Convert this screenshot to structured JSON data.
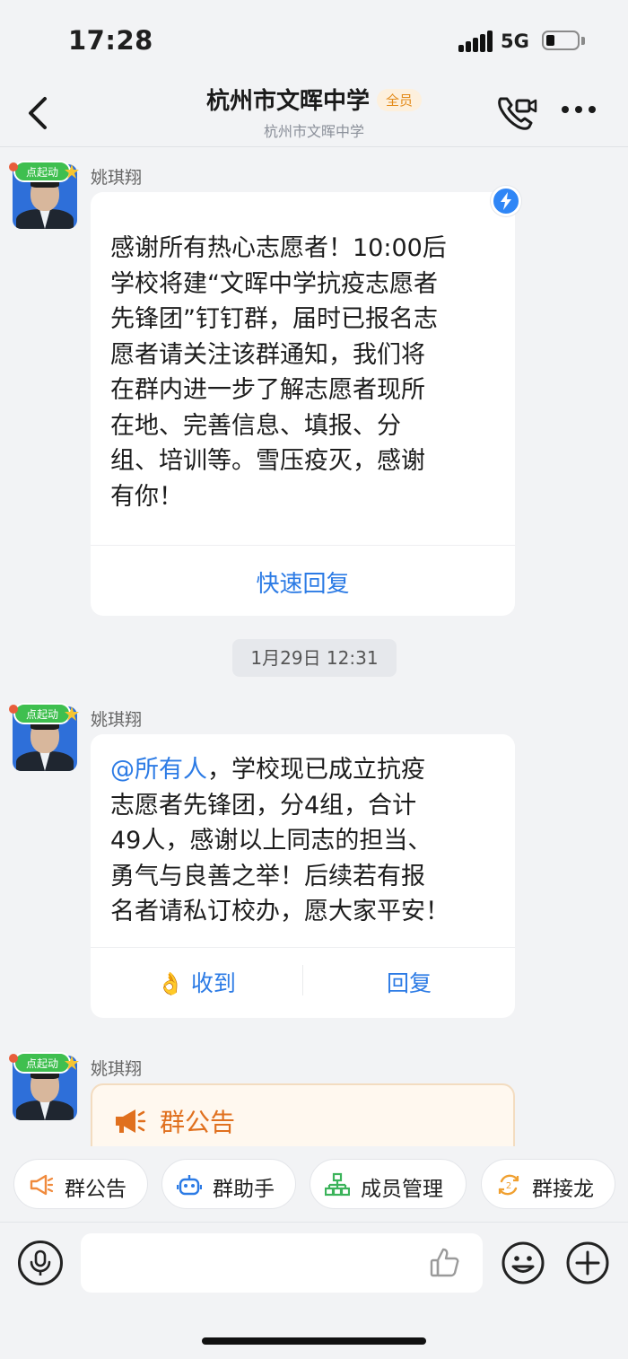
{
  "status_bar": {
    "time": "17:28",
    "network": "5G"
  },
  "header": {
    "title": "杭州市文晖中学",
    "badge": "全员",
    "subtitle": "杭州市文晖中学",
    "icons": [
      "back-icon",
      "video-call-icon",
      "more-icon"
    ]
  },
  "avatar_tag": "点起动",
  "messages": [
    {
      "sender": "姚琪翔",
      "lines": [
        "感谢所有热心志愿者！10:00后",
        "学校将建“文晖中学抗疫志愿者",
        "先锋团”钉钉群，届时已报名志",
        "愿者请关注该群通知，我们将",
        "在群内进一步了解志愿者现所",
        "在地、完善信息、填报、分",
        "组、培训等。雪压疫灭，感谢",
        "有你！"
      ],
      "action": "快速回复"
    },
    {
      "sender": "姚琪翔",
      "mention": "@所有人",
      "first_line_rest": "，学校现已成立抗疫",
      "lines": [
        "志愿者先锋团，分4组，合计",
        "49人，感谢以上同志的担当、",
        "勇气与良善之举！后续若有报",
        "名者请私订校办，愿大家平安！"
      ],
      "action_left": "收到",
      "action_right": "回复"
    },
    {
      "sender": "姚琪翔",
      "announcement_label": "群公告"
    }
  ],
  "timestamp": "1月29日 12:31",
  "toolbar": {
    "items": [
      {
        "label": "群公告",
        "icon": "megaphone-icon"
      },
      {
        "label": "群助手",
        "icon": "robot-icon"
      },
      {
        "label": "成员管理",
        "icon": "org-tree-icon"
      },
      {
        "label": "群接龙",
        "icon": "relay-icon"
      }
    ]
  },
  "input": {
    "value": "",
    "placeholder": ""
  },
  "colors": {
    "accent": "#2c7be5",
    "announce": "#e0701e",
    "badge": "#e38b1a"
  }
}
